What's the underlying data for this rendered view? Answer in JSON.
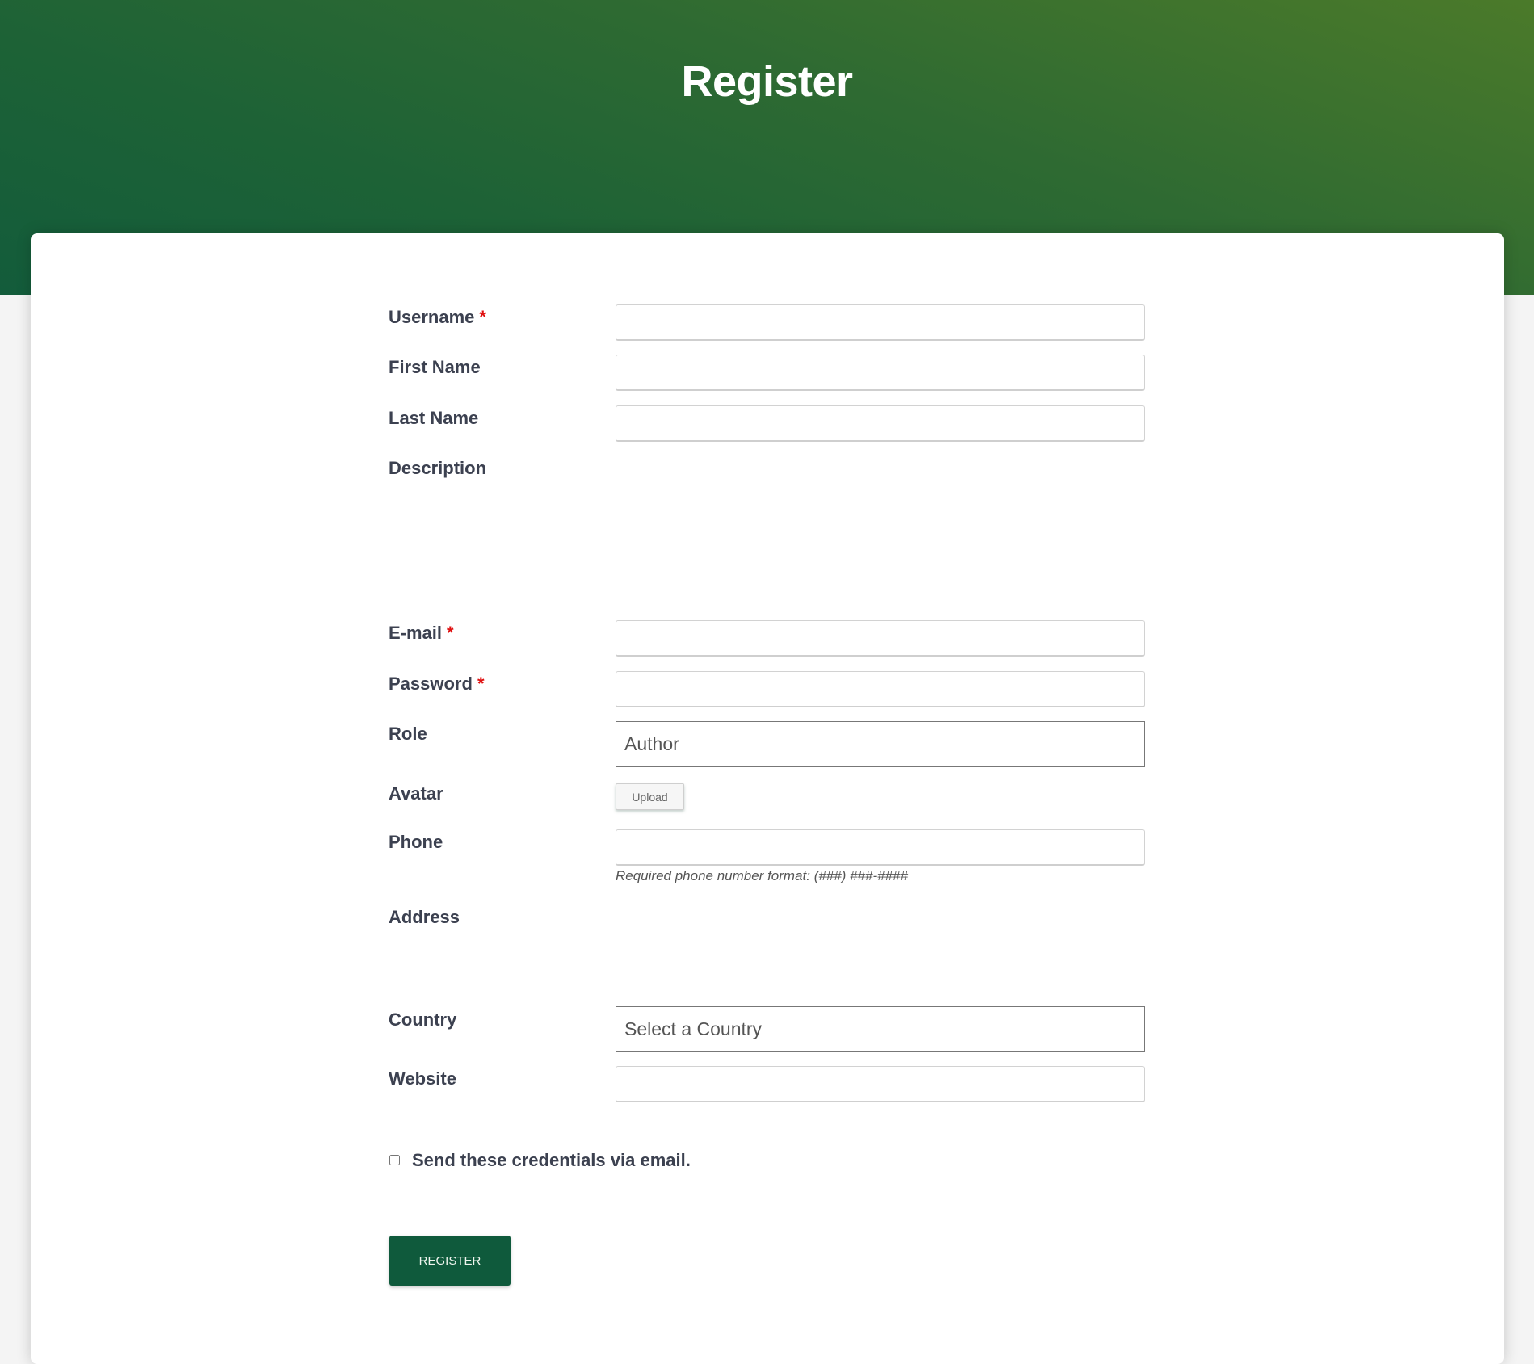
{
  "header": {
    "title": "Register"
  },
  "colors": {
    "header_gradient_start": "#135c3b",
    "header_gradient_end": "#4b7a2a",
    "button_bg": "#0f5a3c",
    "required_star": "#e01010",
    "label_text": "#3c4150"
  },
  "form": {
    "required_marker": "*",
    "fields": {
      "username": {
        "label": "Username",
        "required": true,
        "value": ""
      },
      "first_name": {
        "label": "First Name",
        "required": false,
        "value": ""
      },
      "last_name": {
        "label": "Last Name",
        "required": false,
        "value": ""
      },
      "description": {
        "label": "Description",
        "required": false,
        "value": ""
      },
      "email": {
        "label": "E-mail",
        "required": true,
        "value": ""
      },
      "password": {
        "label": "Password",
        "required": true,
        "value": ""
      },
      "role": {
        "label": "Role",
        "selected": "Author"
      },
      "avatar": {
        "label": "Avatar",
        "button_label": "Upload"
      },
      "phone": {
        "label": "Phone",
        "value": "",
        "help_text": "Required phone number format: (###) ###-####"
      },
      "address": {
        "label": "Address",
        "value": ""
      },
      "country": {
        "label": "Country",
        "selected": "Select a Country"
      },
      "website": {
        "label": "Website",
        "value": ""
      }
    },
    "send_credentials": {
      "label": "Send these credentials via email.",
      "checked": false
    },
    "submit_label": "REGISTER"
  }
}
